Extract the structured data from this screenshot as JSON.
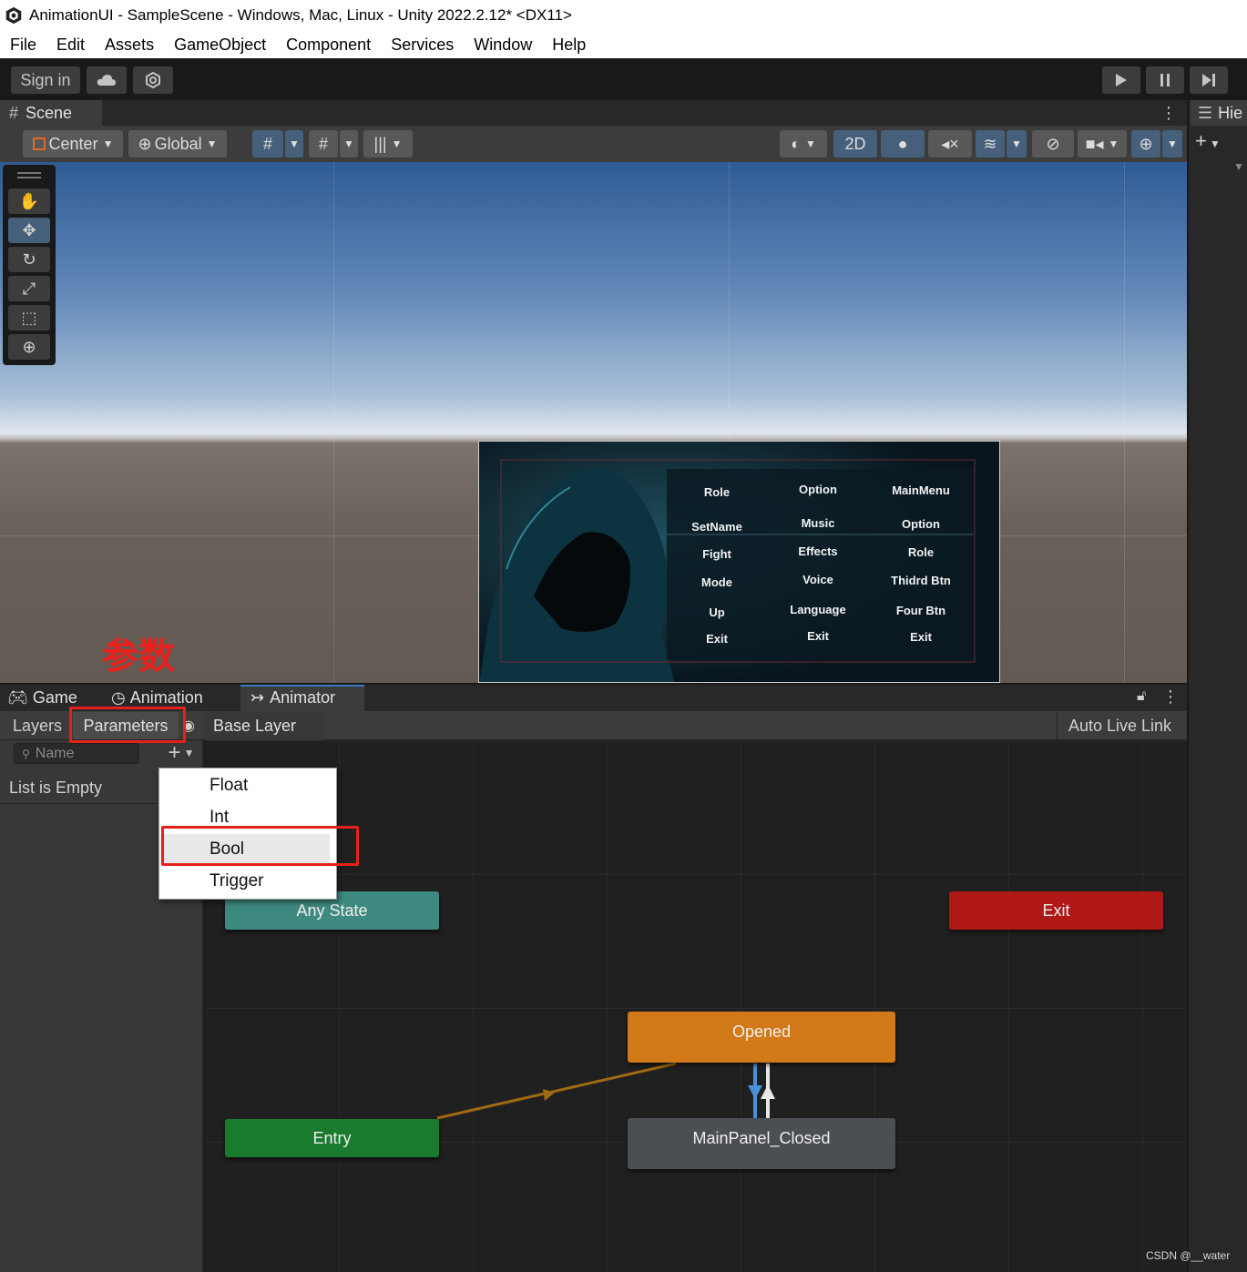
{
  "window": {
    "title": "AnimationUI - SampleScene - Windows, Mac, Linux - Unity 2022.2.12* <DX11>"
  },
  "menubar": [
    "File",
    "Edit",
    "Assets",
    "GameObject",
    "Component",
    "Services",
    "Window",
    "Help"
  ],
  "toolbar": {
    "sign_in": "Sign in",
    "play_icon": "play-icon",
    "pause_icon": "pause-icon",
    "step_icon": "step-icon"
  },
  "scene": {
    "tab": "Scene",
    "pivot": "Center",
    "space": "Global",
    "mode_2d": "2D"
  },
  "hierarchy": {
    "tab": "Hie"
  },
  "ui_canvas": {
    "columns": [
      [
        "Role",
        "SetName",
        "Fight",
        "Mode",
        "Up",
        "Exit"
      ],
      [
        "Option",
        "Music",
        "Effects",
        "Voice",
        "Language",
        "Exit"
      ],
      [
        "MainMenu",
        "Option",
        "Role",
        "Thidrd Btn",
        "Four Btn",
        "Exit"
      ]
    ]
  },
  "annotation": {
    "label": "参数",
    "color": "#e8201c"
  },
  "bottom_tabs": {
    "game": "Game",
    "animation": "Animation",
    "animator": "Animator"
  },
  "animator": {
    "layers_tab": "Layers",
    "parameters_tab": "Parameters",
    "breadcrumb": "Base Layer",
    "auto_live_link": "Auto Live Link",
    "search_placeholder": "Name",
    "list_empty": "List is Empty",
    "add_menu": [
      "Float",
      "Int",
      "Bool",
      "Trigger"
    ],
    "highlighted_item": "Bool",
    "nodes": {
      "any_state": "Any State",
      "exit": "Exit",
      "opened": "Opened",
      "entry": "Entry",
      "closed": "MainPanel_Closed"
    },
    "colors": {
      "any_state": "#3f8a80",
      "exit": "#b01818",
      "opened": "#d2791a",
      "entry": "#1a7a2e",
      "closed": "#4b4e52"
    }
  },
  "watermark": "CSDN @__water"
}
